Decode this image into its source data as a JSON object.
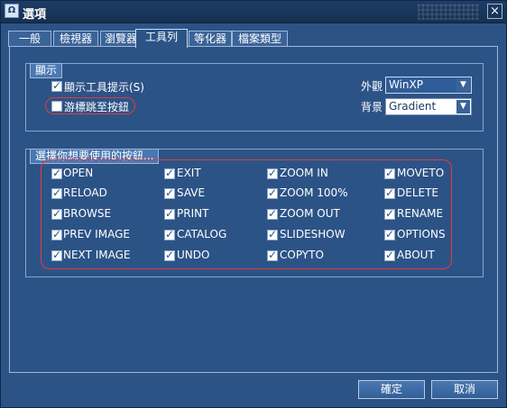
{
  "window": {
    "title": "選項",
    "app_icon_text": "Ω"
  },
  "tabs": [
    {
      "label": "一般"
    },
    {
      "label": "檢視器"
    },
    {
      "label": "瀏覽器"
    },
    {
      "label": "工具列",
      "active": true
    },
    {
      "label": "等化器"
    },
    {
      "label": "檔案類型"
    }
  ],
  "display_group": {
    "title": "顯示",
    "show_tooltips": {
      "label": "顯示工具提示(S)",
      "checked": true
    },
    "cursor_jump": {
      "label": "游標跳至按鈕",
      "checked": false
    },
    "appearance": {
      "label": "外觀",
      "value": "WinXP"
    },
    "background": {
      "label": "背景",
      "value": "Gradient"
    }
  },
  "buttons_group": {
    "title": "選擇你想要使用的按鈕...",
    "columns": [
      [
        "OPEN",
        "RELOAD",
        "BROWSE",
        "PREV IMAGE",
        "NEXT IMAGE"
      ],
      [
        "EXIT",
        "SAVE",
        "PRINT",
        "CATALOG",
        "UNDO"
      ],
      [
        "ZOOM IN",
        "ZOOM 100%",
        "ZOOM OUT",
        "SLIDESHOW",
        "COPYTO"
      ],
      [
        "MOVETO",
        "DELETE",
        "RENAME",
        "OPTIONS",
        "ABOUT"
      ]
    ]
  },
  "footer": {
    "ok_label": "確定",
    "cancel_label": "取消"
  },
  "colors": {
    "window_bg": "#2c5386",
    "title_bg": "#1e3c66",
    "highlight": "#e63a3a"
  },
  "icons": {
    "close": "close-icon",
    "dropdown": "chevron-down-icon",
    "check": "check-icon"
  }
}
